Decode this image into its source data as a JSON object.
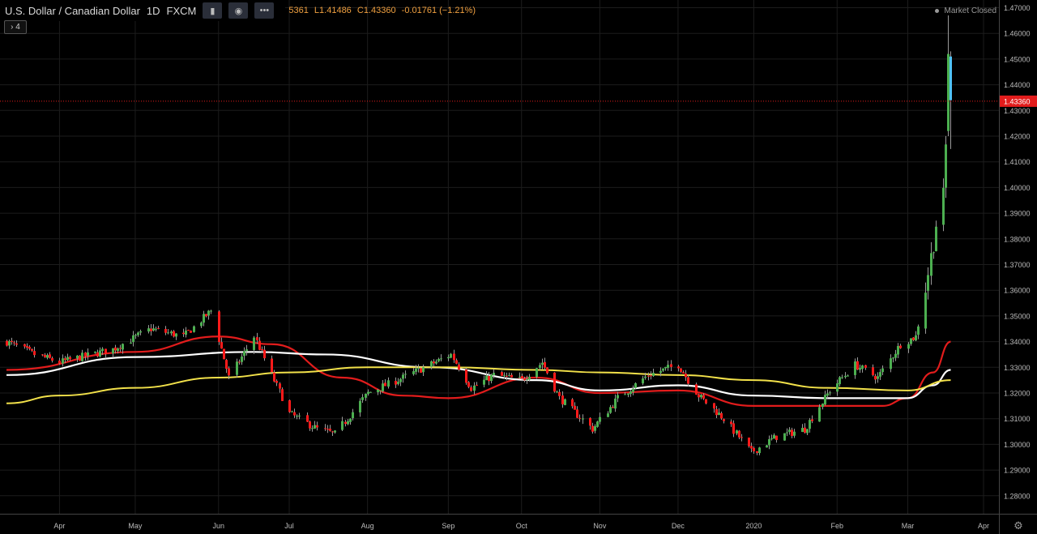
{
  "header": {
    "symbol_name": "U.S. Dollar / Canadian Dollar",
    "interval": "1D",
    "exchange": "FXCM",
    "ohlc": {
      "open_fragment": "5361",
      "low": "L1.41486",
      "close": "C1.43360",
      "change": "-0.01761 (−1.21%)"
    },
    "collapse_label": "4",
    "market_status": "Market Closed"
  },
  "colors": {
    "background": "#000000",
    "grid": "#1c1c1c",
    "up": "#4caf50",
    "down": "#ff1a1a",
    "last_up": "#4fc3f7",
    "ma_red": "#e21c1c",
    "ma_white": "#ffffff",
    "ma_yellow": "#f2e14a",
    "price_tag": "#e21c1c"
  },
  "icons": [
    "chevron-right-icon",
    "eye-icon",
    "more-icon",
    "gear-icon"
  ],
  "chart_data": {
    "type": "candlestick",
    "title": "U.S. Dollar / Canadian Dollar",
    "ylim": [
      1.273,
      1.473
    ],
    "y_ticks": [
      "1.28000",
      "1.29000",
      "1.30000",
      "1.31000",
      "1.32000",
      "1.33000",
      "1.34000",
      "1.35000",
      "1.36000",
      "1.37000",
      "1.38000",
      "1.39000",
      "1.40000",
      "1.41000",
      "1.42000",
      "1.43000",
      "1.44000",
      "1.45000",
      "1.46000",
      "1.47000"
    ],
    "x_labels": [
      {
        "label": "Apr",
        "date": "2019-04-01"
      },
      {
        "label": "May",
        "date": "2019-05-01"
      },
      {
        "label": "Jun",
        "date": "2019-06-03"
      },
      {
        "label": "Jul",
        "date": "2019-07-01"
      },
      {
        "label": "Aug",
        "date": "2019-08-01"
      },
      {
        "label": "Sep",
        "date": "2019-09-02"
      },
      {
        "label": "Oct",
        "date": "2019-10-01"
      },
      {
        "label": "Nov",
        "date": "2019-11-01"
      },
      {
        "label": "Dec",
        "date": "2019-12-02"
      },
      {
        "label": "2020",
        "date": "2020-01-01"
      },
      {
        "label": "Feb",
        "date": "2020-02-03"
      },
      {
        "label": "Mar",
        "date": "2020-03-02"
      },
      {
        "label": "Apr",
        "date": "2020-04-01"
      }
    ],
    "last_price": "1.43360",
    "key_closes": [
      [
        "2019-03-11",
        1.34
      ],
      [
        "2019-03-22",
        1.335
      ],
      [
        "2019-04-01",
        1.332
      ],
      [
        "2019-04-22",
        1.337
      ],
      [
        "2019-05-07",
        1.345
      ],
      [
        "2019-05-20",
        1.342
      ],
      [
        "2019-05-31",
        1.352
      ],
      [
        "2019-06-07",
        1.326
      ],
      [
        "2019-06-17",
        1.342
      ],
      [
        "2019-07-01",
        1.312
      ],
      [
        "2019-07-12",
        1.306
      ],
      [
        "2019-07-19",
        1.304
      ],
      [
        "2019-08-01",
        1.32
      ],
      [
        "2019-08-15",
        1.326
      ],
      [
        "2019-09-03",
        1.335
      ],
      [
        "2019-09-11",
        1.322
      ],
      [
        "2019-09-20",
        1.327
      ],
      [
        "2019-10-01",
        1.325
      ],
      [
        "2019-10-09",
        1.332
      ],
      [
        "2019-10-16",
        1.318
      ],
      [
        "2019-10-29",
        1.306
      ],
      [
        "2019-11-08",
        1.318
      ],
      [
        "2019-11-20",
        1.327
      ],
      [
        "2019-12-02",
        1.331
      ],
      [
        "2019-12-10",
        1.319
      ],
      [
        "2019-12-20",
        1.31
      ],
      [
        "2019-12-31",
        1.297
      ],
      [
        "2020-01-10",
        1.303
      ],
      [
        "2020-01-21",
        1.306
      ],
      [
        "2020-01-31",
        1.321
      ],
      [
        "2020-02-10",
        1.331
      ],
      [
        "2020-02-19",
        1.326
      ],
      [
        "2020-02-28",
        1.339
      ],
      [
        "2020-03-05",
        1.342
      ],
      [
        "2020-03-09",
        1.361
      ],
      [
        "2020-03-12",
        1.379
      ],
      [
        "2020-03-13",
        1.386
      ],
      [
        "2020-03-16",
        1.396
      ],
      [
        "2020-03-17",
        1.416
      ],
      [
        "2020-03-18",
        1.452
      ],
      [
        "2020-03-19",
        1.434
      ]
    ],
    "last_candles": [
      {
        "date": "2020-03-18",
        "o": 1.422,
        "h": 1.467,
        "l": 1.42,
        "c": 1.452
      },
      {
        "date": "2020-03-19",
        "o": 1.451,
        "h": 1.453,
        "l": 1.415,
        "c": 1.434
      }
    ],
    "moving_averages": [
      {
        "name": "red",
        "points": [
          [
            "2019-03-11",
            1.329
          ],
          [
            "2019-05-01",
            1.336
          ],
          [
            "2019-06-03",
            1.342
          ],
          [
            "2019-06-24",
            1.339
          ],
          [
            "2019-07-22",
            1.326
          ],
          [
            "2019-08-15",
            1.319
          ],
          [
            "2019-09-02",
            1.318
          ],
          [
            "2019-10-07",
            1.326
          ],
          [
            "2019-11-01",
            1.32
          ],
          [
            "2019-12-02",
            1.321
          ],
          [
            "2020-01-01",
            1.315
          ],
          [
            "2020-01-30",
            1.315
          ],
          [
            "2020-02-21",
            1.315
          ],
          [
            "2020-03-02",
            1.318
          ],
          [
            "2020-03-12",
            1.328
          ],
          [
            "2020-03-19",
            1.34
          ]
        ]
      },
      {
        "name": "white",
        "points": [
          [
            "2019-03-11",
            1.327
          ],
          [
            "2019-05-01",
            1.334
          ],
          [
            "2019-06-17",
            1.336
          ],
          [
            "2019-07-15",
            1.335
          ],
          [
            "2019-08-26",
            1.33
          ],
          [
            "2019-10-07",
            1.325
          ],
          [
            "2019-11-01",
            1.321
          ],
          [
            "2019-12-02",
            1.323
          ],
          [
            "2020-01-01",
            1.319
          ],
          [
            "2020-01-30",
            1.318
          ],
          [
            "2020-03-02",
            1.318
          ],
          [
            "2020-03-12",
            1.323
          ],
          [
            "2020-03-19",
            1.329
          ]
        ]
      },
      {
        "name": "yellow",
        "points": [
          [
            "2019-03-11",
            1.316
          ],
          [
            "2019-04-01",
            1.319
          ],
          [
            "2019-05-01",
            1.322
          ],
          [
            "2019-06-03",
            1.326
          ],
          [
            "2019-07-01",
            1.328
          ],
          [
            "2019-08-01",
            1.33
          ],
          [
            "2019-09-02",
            1.33
          ],
          [
            "2019-10-07",
            1.329
          ],
          [
            "2019-11-01",
            1.328
          ],
          [
            "2019-12-02",
            1.327
          ],
          [
            "2020-01-01",
            1.325
          ],
          [
            "2020-01-30",
            1.322
          ],
          [
            "2020-03-02",
            1.321
          ],
          [
            "2020-03-19",
            1.325
          ]
        ]
      }
    ]
  }
}
